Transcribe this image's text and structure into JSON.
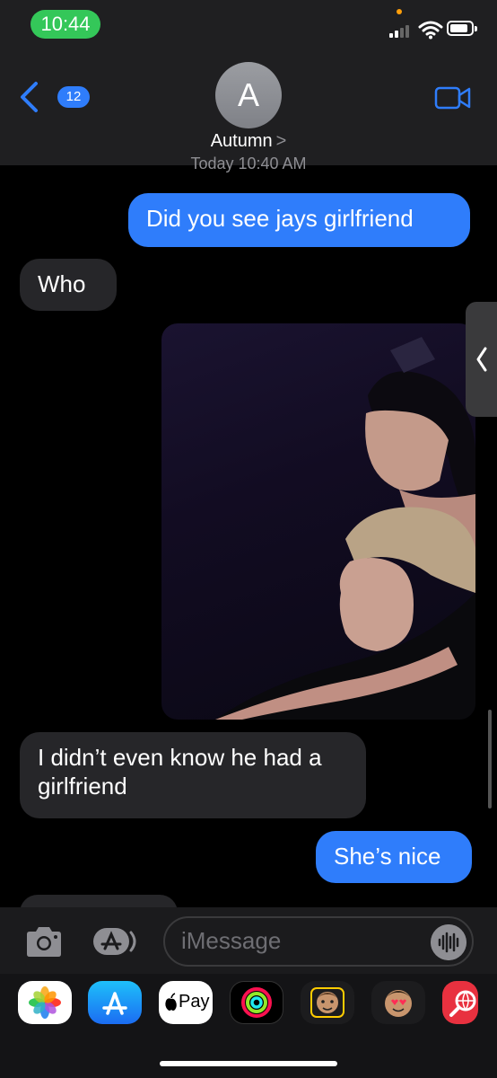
{
  "status": {
    "time": "10:44"
  },
  "header": {
    "back_count": "12",
    "avatar_initial": "A",
    "contact_name": "Autumn",
    "contact_chevron": ">"
  },
  "timestamp": "Today 10:40 AM",
  "messages": [
    {
      "side": "sent",
      "text": "Did you see jays girlfriend"
    },
    {
      "side": "received",
      "text": "Who"
    },
    {
      "side": "received",
      "text": "I didn’t even know he had a girlfriend"
    },
    {
      "side": "sent",
      "text": "She’s nice"
    }
  ],
  "input": {
    "placeholder": "iMessage"
  },
  "apps": {
    "applepay_label": "Pay"
  }
}
